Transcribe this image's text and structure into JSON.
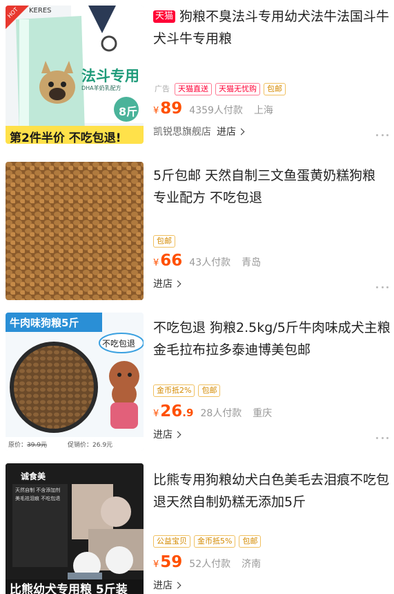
{
  "products": [
    {
      "badge": "天猫",
      "title": "狗粮不臭法斗专用幼犬法牛法国斗牛犬斗牛专用粮",
      "ad_label": "广告",
      "tags": [
        "天猫直送",
        "天猫无忧购",
        "包邮"
      ],
      "price": "89",
      "price_decimal": "",
      "sales": "4359人付款",
      "location": "上海",
      "shop": "凯锐思旗舰店",
      "enter": "进店",
      "image": {
        "hot": "HOT",
        "brand": "KERES",
        "headline": "法斗专用",
        "sub": "DHA羊奶乳配方",
        "weight": "8斤",
        "banner": "第2件半价 不吃包退!"
      }
    },
    {
      "title": "5斤包邮 天然自制三文鱼蛋黄奶糕狗粮 专业配方 不吃包退",
      "tags": [
        "包邮"
      ],
      "price": "66",
      "price_decimal": "",
      "sales": "43人付款",
      "location": "青岛",
      "enter": "进店"
    },
    {
      "title": "不吃包退 狗粮2.5kg/5斤牛肉味成犬主粮金毛拉布拉多泰迪博美包邮",
      "tags": [
        "金币抵2%",
        "包邮"
      ],
      "price": "26",
      "price_decimal": ".9",
      "sales": "28人付款",
      "location": "重庆",
      "enter": "进店",
      "image": {
        "header": "牛肉味狗粮5斤",
        "bubble": "不吃包退",
        "orig_label": "原价：",
        "orig_price": "39.9元",
        "promo_label": "促销价：",
        "promo_price": "26.9元"
      }
    },
    {
      "title": "比熊专用狗粮幼犬白色美毛去泪痕不吃包退天然自制奶糕无添加5斤",
      "tags": [
        "公益宝贝",
        "金币抵5%",
        "包邮"
      ],
      "price": "59",
      "price_decimal": "",
      "sales": "52人付款",
      "location": "济南",
      "enter": "进店",
      "image": {
        "logo": "诚食美",
        "text1": "天然自制 不含添加剂",
        "text2": "美毛祛泪痕 不吃包退",
        "bottom": "比熊幼犬专用粮 5斤装"
      }
    }
  ],
  "colors": {
    "price": "#ff5000",
    "tmall": "#ff0036",
    "tag_orange": "#ff6a00"
  }
}
